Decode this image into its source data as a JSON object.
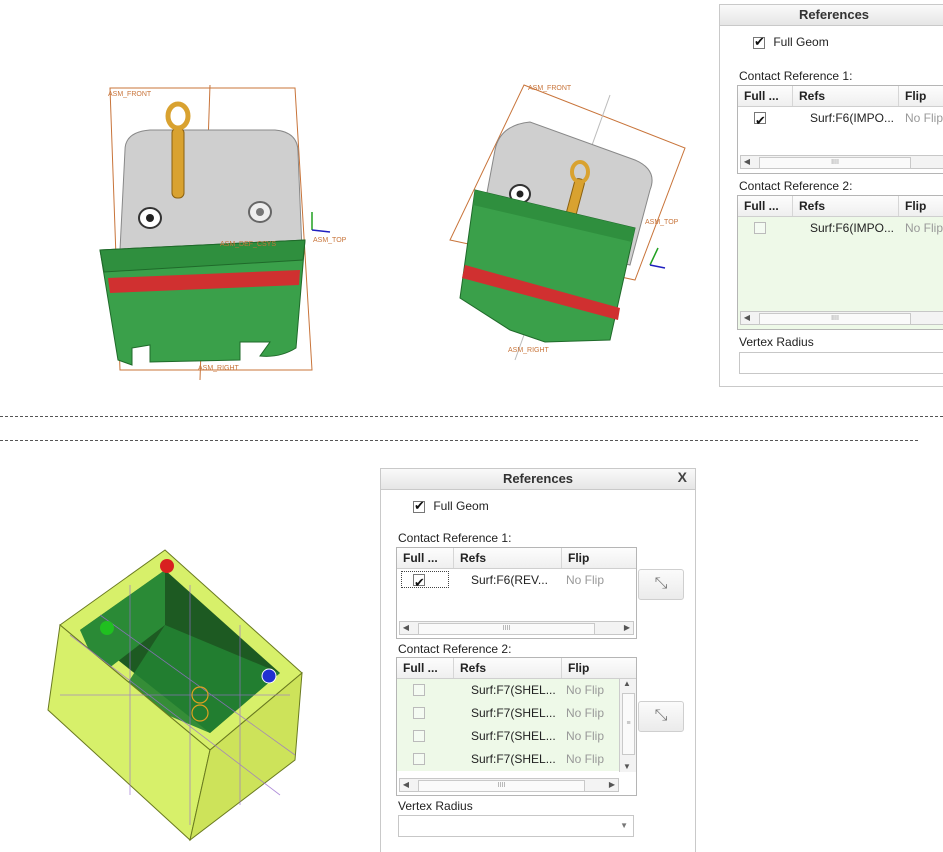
{
  "separators": [
    "",
    ""
  ],
  "panel_top": {
    "title": "References",
    "full_geom_label": "Full Geom",
    "full_geom_checked": true,
    "contact_ref_1": {
      "label": "Contact Reference 1:",
      "columns": [
        "Full ...",
        "Refs",
        "Flip"
      ],
      "rows": [
        {
          "checked": true,
          "ref": "Surf:F6(IMPO...",
          "flip": "No Flip"
        }
      ]
    },
    "contact_ref_2": {
      "label": "Contact Reference 2:",
      "columns": [
        "Full ...",
        "Refs",
        "Flip"
      ],
      "rows": [
        {
          "checked": false,
          "ref": "Surf:F6(IMPO...",
          "flip": "No Flip"
        }
      ]
    },
    "vertex_radius_label": "Vertex Radius"
  },
  "panel_bottom": {
    "title": "References",
    "close_label": "X",
    "full_geom_label": "Full Geom",
    "full_geom_checked": true,
    "contact_ref_1": {
      "label": "Contact Reference 1:",
      "columns": [
        "Full ...",
        "Refs",
        "Flip"
      ],
      "rows": [
        {
          "checked": true,
          "ref": "Surf:F6(REV...",
          "flip": "No Flip"
        }
      ]
    },
    "contact_ref_2": {
      "label": "Contact Reference 2:",
      "columns": [
        "Full ...",
        "Refs",
        "Flip"
      ],
      "rows": [
        {
          "checked": false,
          "ref": "Surf:F7(SHEL...",
          "flip": "No Flip"
        },
        {
          "checked": false,
          "ref": "Surf:F7(SHEL...",
          "flip": "No Flip"
        },
        {
          "checked": false,
          "ref": "Surf:F7(SHEL...",
          "flip": "No Flip"
        },
        {
          "checked": false,
          "ref": "Surf:F7(SHEL...",
          "flip": "No Flip"
        }
      ]
    },
    "vertex_radius_label": "Vertex Radius",
    "scroll_thumb": "IIII"
  },
  "viewport1": {
    "labels": {
      "front": "ASM_FRONT",
      "top": "ASM_TOP",
      "right": "ASM_RIGHT",
      "csys": "ASM_DEF_CSYS"
    }
  },
  "viewport2": {
    "labels": {
      "front": "ASM_FRONT",
      "top": "ASM_TOP",
      "right": "ASM_RIGHT"
    }
  },
  "colors": {
    "green": "#3aa04a",
    "dark_green": "#1f6a2a",
    "red_band": "#d03030",
    "gray_body": "#d4d4d4",
    "gold": "#d9a230",
    "datum": "#c8743a",
    "yellow_green": "#d7f06a"
  },
  "icons": {
    "check": "check-icon",
    "flip": "flip-arrows-icon",
    "close": "close-icon"
  }
}
